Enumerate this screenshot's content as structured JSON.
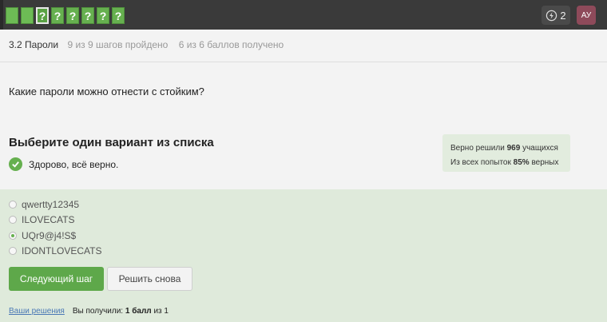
{
  "topbar": {
    "steps": [
      "",
      "",
      "?",
      "?",
      "?",
      "?",
      "?",
      "?"
    ],
    "energy_count": "2",
    "avatar_initials": "АУ"
  },
  "breadcrumb": {
    "lesson": "3.2 Пароли",
    "progress": "9 из 9 шагов пройдено",
    "score": "6 из 6 баллов  получено"
  },
  "question": "Какие пароли можно отнести с стойким?",
  "task": {
    "heading": "Выберите один вариант из списка",
    "feedback": "Здорово, всё верно."
  },
  "stats": {
    "solved_prefix": "Верно решили",
    "solved_count": "969",
    "solved_suffix": "учащихся",
    "attempts_prefix": "Из всех попыток",
    "attempts_percent": "85%",
    "attempts_suffix": "верных"
  },
  "options": [
    {
      "label": "qwertty12345",
      "checked": false
    },
    {
      "label": "ILOVECATS",
      "checked": false
    },
    {
      "label": "UQr9@j4!S$",
      "checked": true
    },
    {
      "label": "IDONTLOVECATS",
      "checked": false
    }
  ],
  "buttons": {
    "next": "Следующий шаг",
    "retry": "Решить снова"
  },
  "footer": {
    "solutions_link": "Ваши решения",
    "result_prefix": "Вы получили:",
    "result_value": "1 балл",
    "result_suffix": "из 1"
  },
  "colors": {
    "accent": "#66b04f",
    "answers_bg": "#dfeadb",
    "topbar_bg": "#3a3a3a"
  }
}
